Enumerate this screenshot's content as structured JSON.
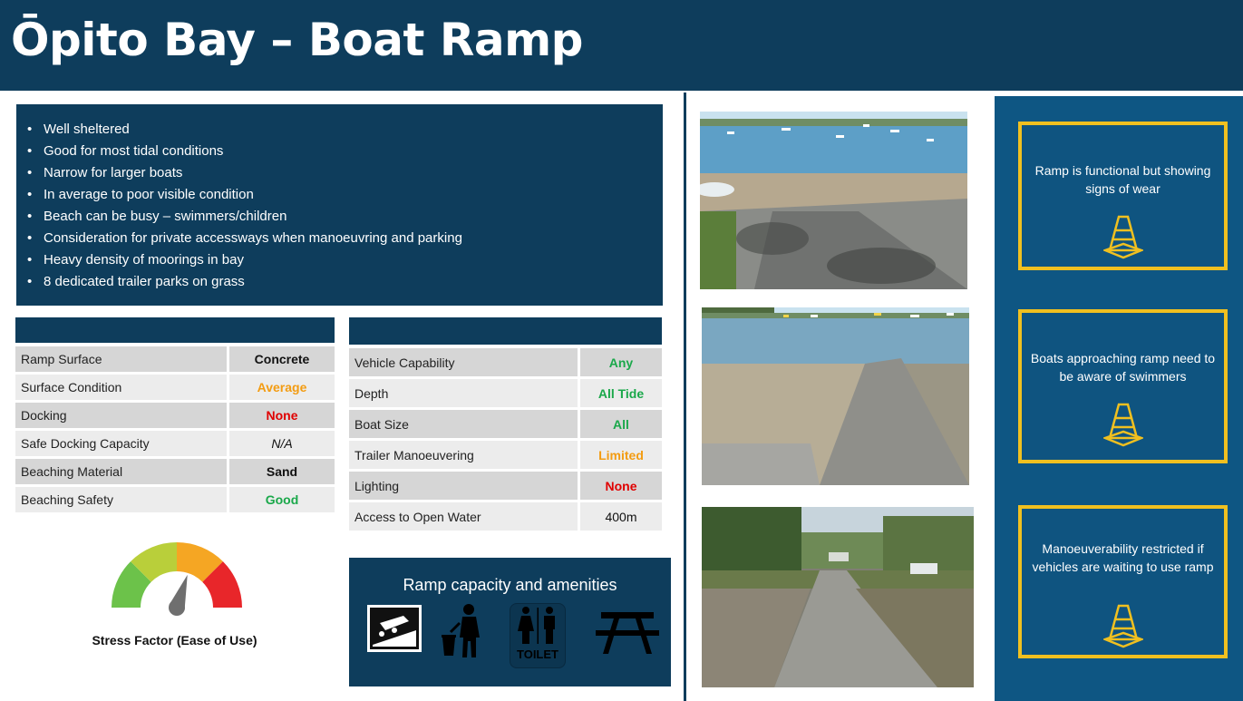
{
  "title": "Ōpito Bay – Boat Ramp",
  "bullets": [
    "Well sheltered",
    "Good for most tidal conditions",
    "Narrow for larger boats",
    "In average to poor visible condition",
    "Beach can be busy – swimmers/children",
    "Consideration for private accessways when manoeuvring and parking",
    "Heavy density of moorings in bay",
    "8 dedicated trailer parks on grass"
  ],
  "table_left": [
    {
      "label": "Ramp Surface",
      "value": "Concrete",
      "color": "#111111",
      "style": "bold"
    },
    {
      "label": "Surface Condition",
      "value": "Average",
      "color": "#f39c12",
      "style": "bold"
    },
    {
      "label": "Docking",
      "value": "None",
      "color": "#e00000",
      "style": "bold"
    },
    {
      "label": "Safe Docking Capacity",
      "value": "N/A",
      "color": "#111111",
      "style": "italic"
    },
    {
      "label": "Beaching Material",
      "value": "Sand",
      "color": "#111111",
      "style": "bold"
    },
    {
      "label": "Beaching Safety",
      "value": "Good",
      "color": "#1aa84a",
      "style": "bold"
    }
  ],
  "table_right": [
    {
      "label": "Vehicle Capability",
      "value": "Any",
      "color": "#1aa84a",
      "style": "bold"
    },
    {
      "label": "Depth",
      "value": "All Tide",
      "color": "#1aa84a",
      "style": "bold"
    },
    {
      "label": "Boat Size",
      "value": "All",
      "color": "#1aa84a",
      "style": "bold"
    },
    {
      "label": "Trailer Manoeuvering",
      "value": "Limited",
      "color": "#f39c12",
      "style": "bold"
    },
    {
      "label": "Lighting",
      "value": "None",
      "color": "#e00000",
      "style": "bold"
    },
    {
      "label": "Access to Open Water",
      "value": "400m",
      "color": "#111111",
      "style": "normal"
    }
  ],
  "stress": {
    "label": "Stress Factor (Ease of Use)",
    "level": 0.6,
    "colors": [
      "#6cc24a",
      "#b9cf3a",
      "#f5a623",
      "#e8262a"
    ]
  },
  "amenities": {
    "caption": "Ramp capacity and amenities",
    "icons": [
      "boat-ramp-icon",
      "rubbish-bin-icon",
      "toilet-icon",
      "picnic-table-icon"
    ],
    "toilet_text": "TOILET"
  },
  "notes": [
    "Ramp is functional but showing signs of wear",
    "Boats approaching ramp need to be aware of swimmers",
    "Manoeuverability restricted if vehicles are waiting to use ramp"
  ],
  "colors": {
    "navy": "#0e3d5c",
    "panel_blue": "#0e5683",
    "gold": "#f0c020"
  }
}
